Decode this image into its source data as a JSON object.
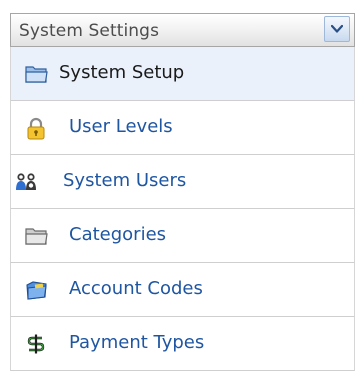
{
  "panel": {
    "title": "System Settings",
    "collapse_icon": "chevron-down-icon",
    "items": [
      {
        "label": "System Setup",
        "icon": "folder-open-icon",
        "selected": true
      },
      {
        "label": "User Levels",
        "icon": "padlock-icon",
        "selected": false
      },
      {
        "label": "System Users",
        "icon": "users-icon",
        "selected": false
      },
      {
        "label": "Categories",
        "icon": "folder-icon",
        "selected": false
      },
      {
        "label": "Account Codes",
        "icon": "blue-folder-icon",
        "selected": false
      },
      {
        "label": "Payment Types",
        "icon": "dollar-icon",
        "selected": false
      }
    ]
  },
  "colors": {
    "link": "#1f56a2",
    "selected_background": "#eaf1fb",
    "divider": "#cfcfcf"
  }
}
